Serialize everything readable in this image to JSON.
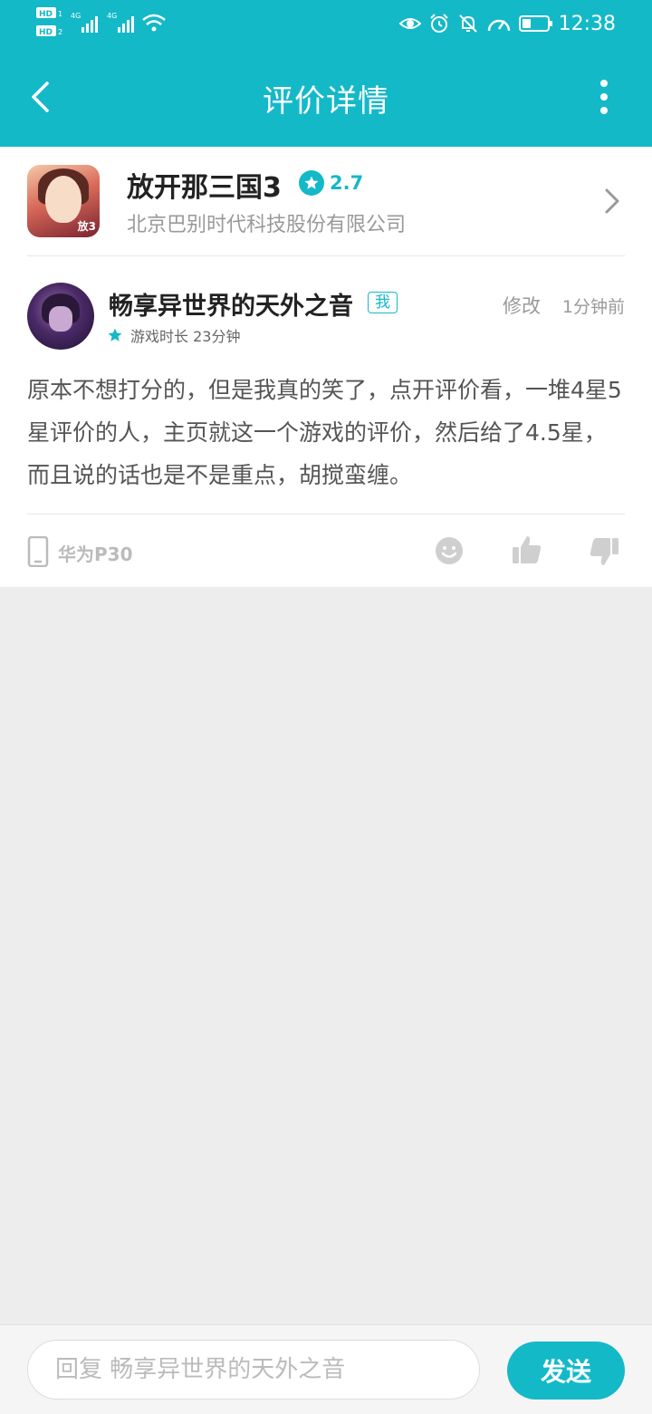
{
  "status_bar": {
    "time": "12:38",
    "left_icons": [
      "hd-sim-icon",
      "signal-4g-icon",
      "signal-4g-icon",
      "wifi-icon"
    ],
    "right_icons": [
      "eye-icon",
      "alarm-icon",
      "mute-bell-icon",
      "speed-icon",
      "battery-icon"
    ]
  },
  "header": {
    "title": "评价详情",
    "back_icon": "chevron-left-icon",
    "menu_icon": "more-vertical-icon",
    "background": "#14b9c8"
  },
  "game": {
    "name": "放开那三国3",
    "rating": "2.7",
    "developer": "北京巴别时代科技股份有限公司",
    "icon_badge": "放3"
  },
  "review": {
    "user_name": "畅享异世界的天外之音",
    "me_tag": "我",
    "edit_label": "修改",
    "time_ago": "1分钟前",
    "playtime": "游戏时长 23分钟",
    "content": "原本不想打分的，但是我真的笑了，点开评价看，一堆4星5星评价的人，主页就这一个游戏的评价，然后给了4.5星，而且说的话也是不是重点，胡搅蛮缠。",
    "device": "华为P30"
  },
  "reply": {
    "placeholder": "回复 畅享异世界的天外之音",
    "send_label": "发送"
  },
  "colors": {
    "accent": "#14b9c8",
    "page_bg": "#ededed"
  }
}
